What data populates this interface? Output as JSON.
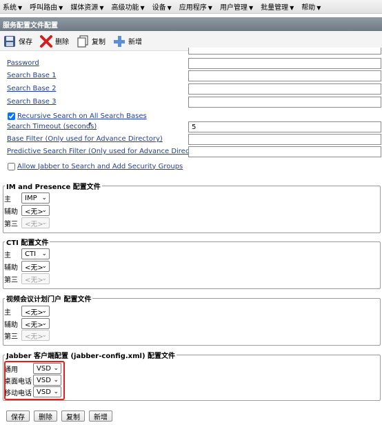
{
  "menu": [
    {
      "label": "系统"
    },
    {
      "label": "呼叫路由"
    },
    {
      "label": "媒体资源"
    },
    {
      "label": "高级功能"
    },
    {
      "label": "设备"
    },
    {
      "label": "应用程序"
    },
    {
      "label": "用户管理"
    },
    {
      "label": "批量管理"
    },
    {
      "label": "帮助"
    }
  ],
  "page_title": "服务配置文件配置",
  "toolbar": {
    "save_label": "保存",
    "delete_label": "删除",
    "copy_label": "复制",
    "add_label": "新增"
  },
  "ldap": {
    "password_label": "Password",
    "search_base_1_label": "Search Base 1",
    "search_base_2_label": "Search Base 2",
    "search_base_3_label": "Search Base 3",
    "recursive_label": "Recursive Search on All Search Bases",
    "recursive_checked": true,
    "timeout_label": "Search Timeout (seconds)",
    "timeout_required": "*",
    "timeout_value": "5",
    "base_filter_label": "Base Filter (Only used for Advance Directory)",
    "predictive_filter_label": "Predictive Search Filter (Only used for Advance Directory)",
    "allow_jabber_label": "Allow Jabber to Search and Add Security Groups",
    "allow_jabber_checked": false
  },
  "im_presence": {
    "legend": "IM and Presence 配置文件",
    "primary_label": "主",
    "primary_value": "IMP",
    "secondary_label": "辅助",
    "secondary_value": "<无>",
    "tertiary_label": "第三",
    "tertiary_value": "<无>"
  },
  "cti": {
    "legend": "CTI 配置文件",
    "primary_label": "主",
    "primary_value": "CTI",
    "secondary_label": "辅助",
    "secondary_value": "<无>",
    "tertiary_label": "第三",
    "tertiary_value": "<无>"
  },
  "video_portal": {
    "legend": "视频会议计划门户 配置文件",
    "primary_label": "主",
    "primary_value": "<无>",
    "secondary_label": "辅助",
    "secondary_value": "<无>",
    "tertiary_label": "第三",
    "tertiary_value": "<无>"
  },
  "jabber": {
    "legend": "Jabber 客户端配置 (jabber-config.xml) 配置文件",
    "common_label": "通用",
    "common_value": "VSD",
    "desk_label": "桌面电话",
    "desk_value": "VSD",
    "mobile_label": "移动电话",
    "mobile_value": "VSD"
  },
  "bottom": {
    "save_label": "保存",
    "delete_label": "删除",
    "copy_label": "复制",
    "add_label": "新增"
  }
}
